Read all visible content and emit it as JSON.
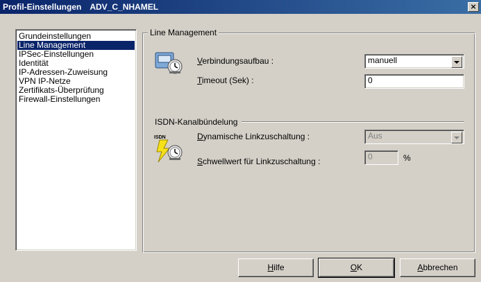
{
  "window": {
    "title_prefix": "Profil-Einstellungen",
    "title_profile": "ADV_C_NHAMEL",
    "close_glyph": "×"
  },
  "nav": {
    "items": [
      {
        "label": "Grundeinstellungen",
        "selected": false
      },
      {
        "label": "Line Management",
        "selected": true
      },
      {
        "label": "IPSec-Einstellungen",
        "selected": false
      },
      {
        "label": "Identität",
        "selected": false
      },
      {
        "label": "IP-Adressen-Zuweisung",
        "selected": false
      },
      {
        "label": "VPN IP-Netze",
        "selected": false
      },
      {
        "label": "Zertifikats-Überprüfung",
        "selected": false
      },
      {
        "label": "Firewall-Einstellungen",
        "selected": false
      }
    ]
  },
  "panel": {
    "title": "Line Management",
    "connection": {
      "label_first": "V",
      "label_rest": "erbindungsaufbau :",
      "value": "manuell",
      "icon": "phone-clock-icon"
    },
    "timeout": {
      "label_first": "T",
      "label_rest": "imeout (Sek) :",
      "value": "0"
    },
    "isdn_group": {
      "title": "ISDN-Kanalbündelung",
      "icon": "isdn-lightning-clock-icon",
      "icon_text": "ISDN",
      "dynamic": {
        "label_first": "D",
        "label_rest": "ynamische Linkzuschaltung :",
        "value": "Aus"
      },
      "threshold": {
        "label_first": "S",
        "label_rest": "chwellwert für Linkzuschaltung :",
        "value": "0",
        "unit": "%"
      }
    }
  },
  "buttons": {
    "help": {
      "first": "H",
      "rest": "ilfe"
    },
    "ok": {
      "first": "O",
      "rest": "K"
    },
    "cancel": {
      "first": "A",
      "rest": "bbrechen"
    }
  },
  "colors": {
    "titlebar_start": "#0a246a",
    "titlebar_end": "#3a6ea5",
    "selection": "#0a246a",
    "face": "#d4d0c8"
  }
}
